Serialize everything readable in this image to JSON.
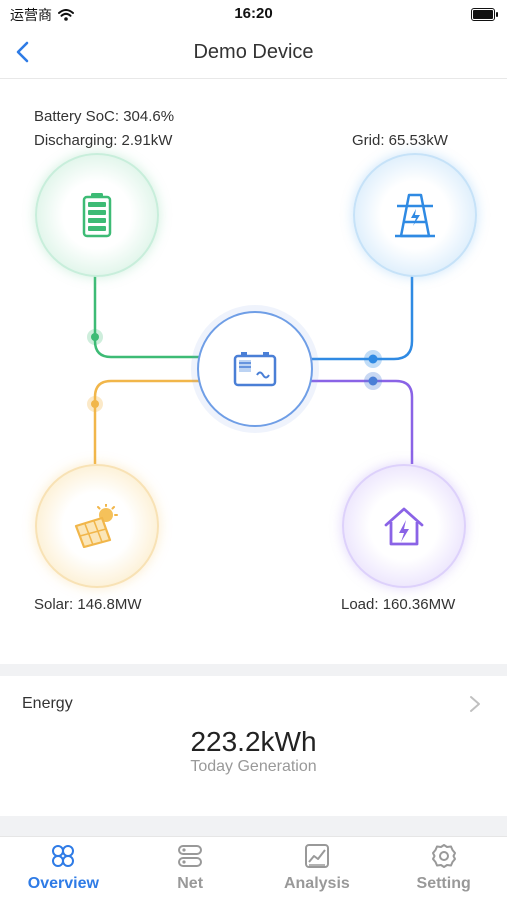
{
  "status_bar": {
    "carrier": "运营商",
    "time": "16:20"
  },
  "nav": {
    "title": "Demo Device"
  },
  "flow": {
    "battery": {
      "soc_label": "Battery SoC: 304.6%",
      "discharge_label": "Discharging: 2.91kW",
      "color": "#3dbb75"
    },
    "grid": {
      "label": "Grid: 65.53kW",
      "color": "#2f8ae3"
    },
    "solar": {
      "label": "Solar: 146.8MW",
      "color": "#f1b64a"
    },
    "load": {
      "label": "Load: 160.36MW",
      "color": "#8a63e6"
    },
    "inverter": {
      "color": "#4a7fd6"
    }
  },
  "energy": {
    "label": "Energy",
    "value": "223.2kWh",
    "subtitle": "Today Generation"
  },
  "tabs": [
    {
      "label": "Overview",
      "icon": "overview-icon",
      "active": true
    },
    {
      "label": "Net",
      "icon": "net-icon",
      "active": false
    },
    {
      "label": "Analysis",
      "icon": "analysis-icon",
      "active": false
    },
    {
      "label": "Setting",
      "icon": "setting-icon",
      "active": false
    }
  ],
  "colors": {
    "accent": "#2e7be6",
    "inactive": "#999999"
  }
}
